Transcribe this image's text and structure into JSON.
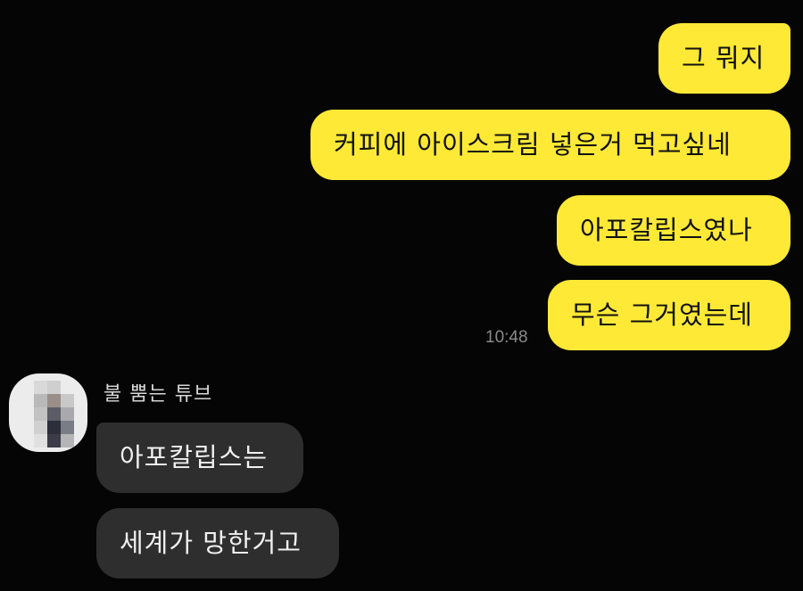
{
  "conversation": {
    "outgoing": [
      {
        "text": "그 뭐지"
      },
      {
        "text": "커피에 아이스크림 넣은거 먹고싶네"
      },
      {
        "text": "아포칼립스였나"
      },
      {
        "text": "무슨 그거였는데"
      }
    ],
    "outgoing_time": "10:48",
    "incoming_sender": {
      "name": "불 뿜는 튜브",
      "avatar_icon": "blurred-profile-photo"
    },
    "incoming": [
      {
        "text": "아포칼립스는"
      },
      {
        "text": "세계가 망한거고"
      }
    ]
  },
  "colors": {
    "background": "#050505",
    "outgoing_bubble": "#fde936",
    "incoming_bubble": "#2e2e2e",
    "timestamp": "#8a8a8a"
  }
}
